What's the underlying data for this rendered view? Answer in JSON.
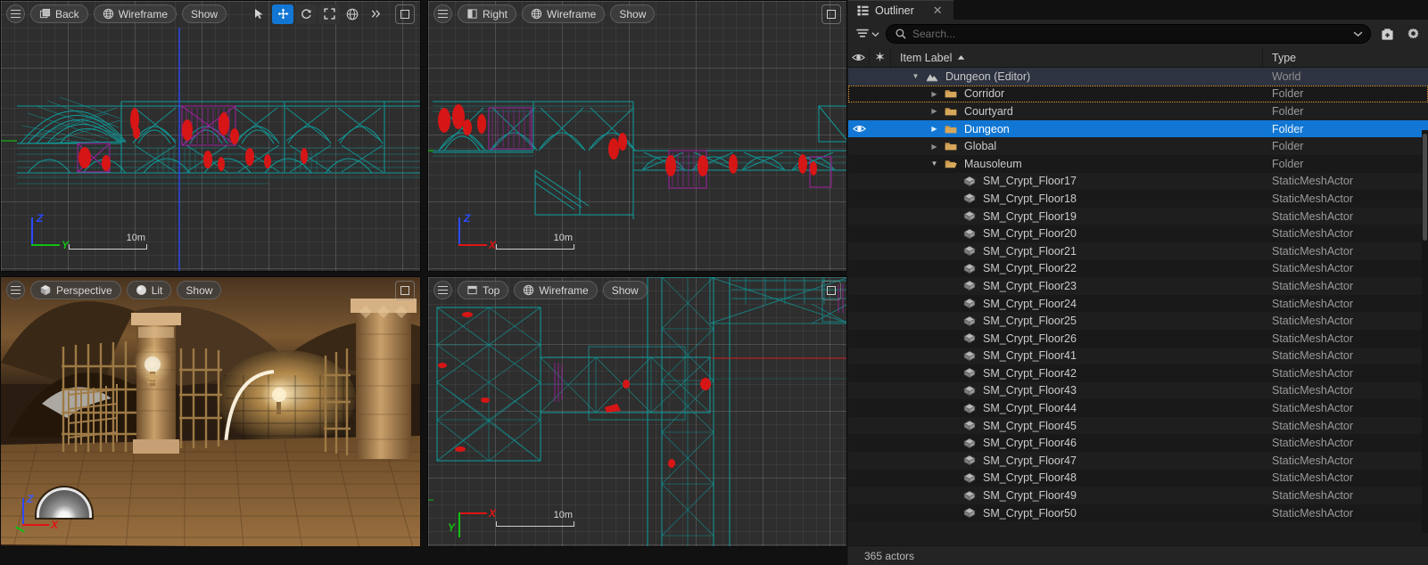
{
  "viewports": {
    "top_left": {
      "name": "back-viewport",
      "menu_icon": "hamburger-icon",
      "view_mode": "Back",
      "view_mode_icon": "orthographic-back-icon",
      "shading": "Wireframe",
      "shading_icon": "globe-icon",
      "show": "Show",
      "axis": {
        "vertical": "Z",
        "horizontal": "Y",
        "vertical_color": "#2b4bff",
        "horizontal_color": "#12c012"
      },
      "scale": "10m",
      "gizmos": [
        {
          "name": "select-tool",
          "icon": "cursor-arrow-icon",
          "active": false
        },
        {
          "name": "translate-tool",
          "icon": "move-arrows-icon",
          "active": true
        },
        {
          "name": "rotate-tool",
          "icon": "rotate-icon",
          "active": false
        },
        {
          "name": "scale-tool",
          "icon": "scale-icon",
          "active": false
        },
        {
          "name": "coordinate-system",
          "icon": "globe-icon",
          "active": false
        },
        {
          "name": "more-options",
          "icon": "chevron-double-right-icon",
          "active": false
        }
      ],
      "maximize": "maximize-icon"
    },
    "top_right": {
      "name": "right-viewport",
      "menu_icon": "hamburger-icon",
      "view_mode": "Right",
      "view_mode_icon": "orthographic-right-icon",
      "shading": "Wireframe",
      "shading_icon": "globe-icon",
      "show": "Show",
      "axis": {
        "vertical": "Z",
        "horizontal": "X",
        "vertical_color": "#2b4bff",
        "horizontal_color": "#e01414"
      },
      "scale": "10m",
      "maximize": "maximize-icon"
    },
    "bottom_left": {
      "name": "perspective-viewport",
      "menu_icon": "hamburger-icon",
      "view_mode": "Perspective",
      "view_mode_icon": "cube-icon",
      "shading": "Lit",
      "shading_icon": "sphere-icon",
      "show": "Show",
      "axis": {
        "vertical": "Z",
        "horizontal": "X",
        "vertical_color": "#2b4bff",
        "horizontal_color": "#e01414"
      },
      "nav_widget": "horizon-dome-icon",
      "maximize": "maximize-icon"
    },
    "bottom_right": {
      "name": "top-viewport",
      "menu_icon": "hamburger-icon",
      "view_mode": "Top",
      "view_mode_icon": "orthographic-top-icon",
      "shading": "Wireframe",
      "shading_icon": "globe-icon",
      "show": "Show",
      "axis": {
        "vertical": "Y",
        "horizontal": "X",
        "vertical_color": "#12c012",
        "horizontal_color": "#e01414"
      },
      "scale": "10m",
      "maximize": "maximize-icon"
    }
  },
  "outliner": {
    "tab": {
      "title": "Outliner",
      "icon": "outliner-icon",
      "close_icon": "close-icon"
    },
    "search": {
      "filter_icon": "filter-icon",
      "filter_chevron_icon": "chevron-down-icon",
      "search_icon": "search-icon",
      "value": "",
      "placeholder": "Search...",
      "dropdown_icon": "chevron-down-icon",
      "add_icon": "add-item-icon",
      "settings_icon": "gear-icon"
    },
    "columns": {
      "visibility_icon": "eye-icon",
      "pin_icon": "star-icon",
      "label": "Item Label",
      "sort_icon": "sort-ascending-icon",
      "type": "Type"
    },
    "status": "365 actors",
    "rows": [
      {
        "label": "Dungeon (Editor)",
        "type": "World",
        "depth": 1,
        "icon": "world-icon",
        "twisty": "open",
        "state": "world",
        "eye": false
      },
      {
        "label": "Corridor",
        "type": "Folder",
        "depth": 2,
        "icon": "folder-icon",
        "twisty": "closed",
        "state": "focused",
        "eye": false
      },
      {
        "label": "Courtyard",
        "type": "Folder",
        "depth": 2,
        "icon": "folder-icon",
        "twisty": "closed",
        "state": "normal",
        "eye": false
      },
      {
        "label": "Dungeon",
        "type": "Folder",
        "depth": 2,
        "icon": "folder-icon",
        "twisty": "closed",
        "state": "selected",
        "eye": true
      },
      {
        "label": "Global",
        "type": "Folder",
        "depth": 2,
        "icon": "folder-icon",
        "twisty": "closed",
        "state": "normal",
        "eye": false
      },
      {
        "label": "Mausoleum",
        "type": "Folder",
        "depth": 2,
        "icon": "folder-open-icon",
        "twisty": "open",
        "state": "normal",
        "eye": false
      },
      {
        "label": "SM_Crypt_Floor17",
        "type": "StaticMeshActor",
        "depth": 3,
        "icon": "mesh-icon",
        "twisty": "none",
        "state": "normal",
        "eye": false
      },
      {
        "label": "SM_Crypt_Floor18",
        "type": "StaticMeshActor",
        "depth": 3,
        "icon": "mesh-icon",
        "twisty": "none",
        "state": "normal",
        "eye": false
      },
      {
        "label": "SM_Crypt_Floor19",
        "type": "StaticMeshActor",
        "depth": 3,
        "icon": "mesh-icon",
        "twisty": "none",
        "state": "normal",
        "eye": false
      },
      {
        "label": "SM_Crypt_Floor20",
        "type": "StaticMeshActor",
        "depth": 3,
        "icon": "mesh-icon",
        "twisty": "none",
        "state": "normal",
        "eye": false
      },
      {
        "label": "SM_Crypt_Floor21",
        "type": "StaticMeshActor",
        "depth": 3,
        "icon": "mesh-icon",
        "twisty": "none",
        "state": "normal",
        "eye": false
      },
      {
        "label": "SM_Crypt_Floor22",
        "type": "StaticMeshActor",
        "depth": 3,
        "icon": "mesh-icon",
        "twisty": "none",
        "state": "normal",
        "eye": false
      },
      {
        "label": "SM_Crypt_Floor23",
        "type": "StaticMeshActor",
        "depth": 3,
        "icon": "mesh-icon",
        "twisty": "none",
        "state": "normal",
        "eye": false
      },
      {
        "label": "SM_Crypt_Floor24",
        "type": "StaticMeshActor",
        "depth": 3,
        "icon": "mesh-icon",
        "twisty": "none",
        "state": "normal",
        "eye": false
      },
      {
        "label": "SM_Crypt_Floor25",
        "type": "StaticMeshActor",
        "depth": 3,
        "icon": "mesh-icon",
        "twisty": "none",
        "state": "normal",
        "eye": false
      },
      {
        "label": "SM_Crypt_Floor26",
        "type": "StaticMeshActor",
        "depth": 3,
        "icon": "mesh-icon",
        "twisty": "none",
        "state": "normal",
        "eye": false
      },
      {
        "label": "SM_Crypt_Floor41",
        "type": "StaticMeshActor",
        "depth": 3,
        "icon": "mesh-icon",
        "twisty": "none",
        "state": "normal",
        "eye": false
      },
      {
        "label": "SM_Crypt_Floor42",
        "type": "StaticMeshActor",
        "depth": 3,
        "icon": "mesh-icon",
        "twisty": "none",
        "state": "normal",
        "eye": false
      },
      {
        "label": "SM_Crypt_Floor43",
        "type": "StaticMeshActor",
        "depth": 3,
        "icon": "mesh-icon",
        "twisty": "none",
        "state": "normal",
        "eye": false
      },
      {
        "label": "SM_Crypt_Floor44",
        "type": "StaticMeshActor",
        "depth": 3,
        "icon": "mesh-icon",
        "twisty": "none",
        "state": "normal",
        "eye": false
      },
      {
        "label": "SM_Crypt_Floor45",
        "type": "StaticMeshActor",
        "depth": 3,
        "icon": "mesh-icon",
        "twisty": "none",
        "state": "normal",
        "eye": false
      },
      {
        "label": "SM_Crypt_Floor46",
        "type": "StaticMeshActor",
        "depth": 3,
        "icon": "mesh-icon",
        "twisty": "none",
        "state": "normal",
        "eye": false
      },
      {
        "label": "SM_Crypt_Floor47",
        "type": "StaticMeshActor",
        "depth": 3,
        "icon": "mesh-icon",
        "twisty": "none",
        "state": "normal",
        "eye": false
      },
      {
        "label": "SM_Crypt_Floor48",
        "type": "StaticMeshActor",
        "depth": 3,
        "icon": "mesh-icon",
        "twisty": "none",
        "state": "normal",
        "eye": false
      },
      {
        "label": "SM_Crypt_Floor49",
        "type": "StaticMeshActor",
        "depth": 3,
        "icon": "mesh-icon",
        "twisty": "none",
        "state": "normal",
        "eye": false
      },
      {
        "label": "SM_Crypt_Floor50",
        "type": "StaticMeshActor",
        "depth": 3,
        "icon": "mesh-icon",
        "twisty": "none",
        "state": "normal",
        "eye": false
      }
    ]
  },
  "colors": {
    "accent_selected": "#1277d4",
    "focus_outline": "#e09a30",
    "wireframe": "#0f9c9c",
    "wireframe_selected": "#a020a0",
    "wireframe_highlight": "#e01414",
    "folder": "#c9964b"
  }
}
